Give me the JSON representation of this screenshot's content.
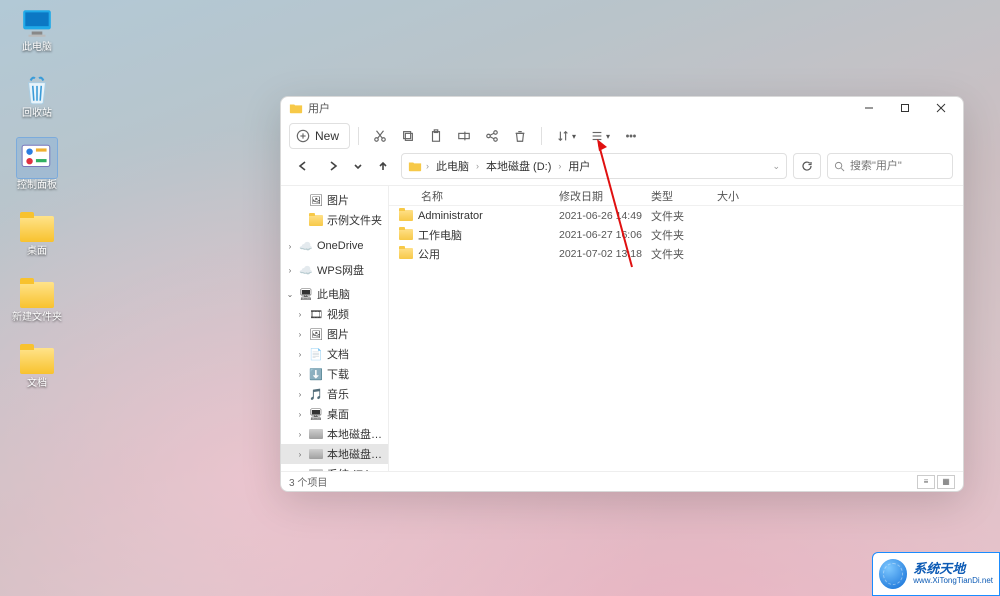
{
  "desktop": {
    "icons": [
      {
        "label": "此电脑"
      },
      {
        "label": "回收站"
      },
      {
        "label": "控制面板"
      },
      {
        "label": "桌面"
      },
      {
        "label": "新建文件夹"
      },
      {
        "label": "文档"
      }
    ]
  },
  "window": {
    "title": "用户",
    "toolbar": {
      "new_label": "New"
    },
    "breadcrumb": {
      "root": "此电脑",
      "drive": "本地磁盘 (D:)",
      "folder": "用户"
    },
    "search": {
      "placeholder": "搜索\"用户\""
    },
    "columns": {
      "name": "名称",
      "date": "修改日期",
      "type": "类型",
      "size": "大小"
    },
    "files": [
      {
        "name": "Administrator",
        "date": "2021-06-26 14:49",
        "type": "文件夹"
      },
      {
        "name": "工作电脑",
        "date": "2021-06-27 16:06",
        "type": "文件夹"
      },
      {
        "name": "公用",
        "date": "2021-07-02 13:18",
        "type": "文件夹"
      }
    ],
    "sidebar": {
      "pictures": "图片",
      "samples": "示例文件夹",
      "onedrive": "OneDrive",
      "wps": "WPS网盘",
      "this_pc": "此电脑",
      "videos": "视频",
      "pictures2": "图片",
      "documents": "文档",
      "downloads": "下载",
      "music": "音乐",
      "desktop": "桌面",
      "drive_c": "本地磁盘 (C:)",
      "drive_d": "本地磁盘 (D:)",
      "drive_e": "系统 (E:)"
    },
    "status": "3 个项目"
  },
  "watermark": {
    "line1": "系统天地",
    "line2": "www.XiTongTianDi.net"
  }
}
